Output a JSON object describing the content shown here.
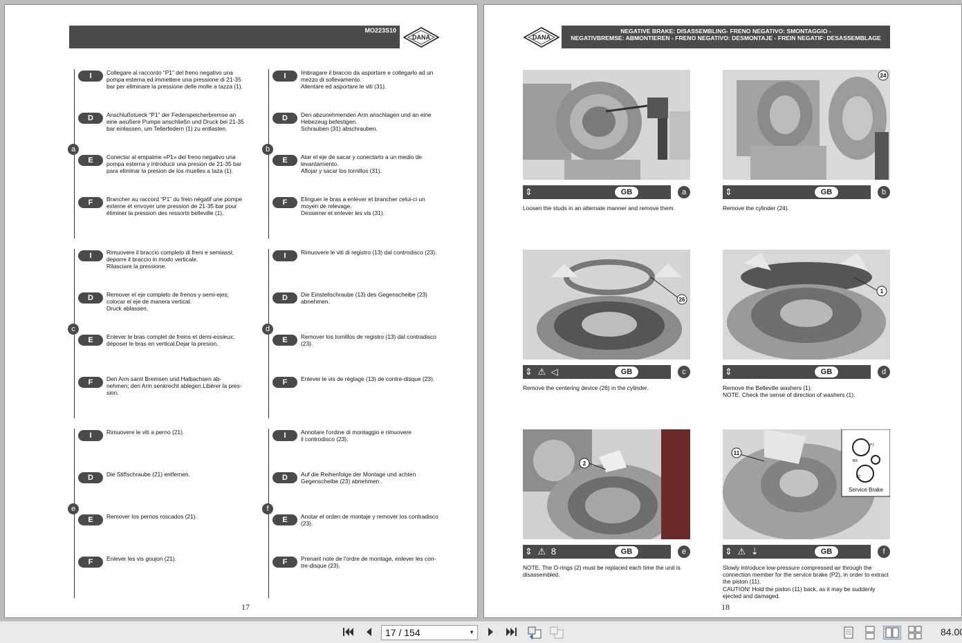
{
  "left_page": {
    "code": "MO223S10",
    "logo_text": "DANA",
    "page_number": "17",
    "blocks": [
      {
        "letter": "a",
        "rows": [
          {
            "lang": "I",
            "text": "Collegare al raccordo “P1” del freno negativo una\npompa esterna ed immettere una pressione di 21-35\nbar per eliminare la pressione delle molle a tazza (1)."
          },
          {
            "lang": "D",
            "text": "Anschlußstueck “P1” der Federspeicherbremse an\neine aeußere Pumpe anschließn und Druck bei 21-35\nbar einlassen, um Tellerfedern (1) zu entlasten."
          },
          {
            "lang": "E",
            "text": "Conectar al empalme «P1» del freno negativo una\npompa esterna y introducir una presion de 21-35 bar\npara eliminar la presion de los muelles a taza (1)."
          },
          {
            "lang": "F",
            "text": "Brancher au raccord “P1” du frein négatif une pompe\nexterne et envoyer une pression de 21-35 bar pour\néliminer la pression des ressorts belleville (1)."
          }
        ]
      },
      {
        "letter": "b",
        "rows": [
          {
            "lang": "I",
            "text": "Imbragare il braccio da asportare e collegarlo ad un\nmezzo di sollevamento.\nAllentare ed asportare le viti (31)."
          },
          {
            "lang": "D",
            "text": "Den abzunehmenden Arm anschlagen und an eine\nHebezeug befestigen.\nSchrauben (31) abschrauben."
          },
          {
            "lang": "E",
            "text": "Atar el eje de sacar y conectarlo a un medio de\nlevantamiento.\nAflojar y sacar los tornillos (31)."
          },
          {
            "lang": "F",
            "text": "Elinguer le bras a enlever et brancher celui-ci un\nmoyen de relevage.\nDesserrer et enlever les vis (31)."
          }
        ]
      },
      {
        "letter": "c",
        "rows": [
          {
            "lang": "I",
            "text": "Rimuovere il braccio completo di freni e semiassi;\ndeporre il braccio in modo verticale.\nRilasciare la pressione."
          },
          {
            "lang": "D",
            "text": "Remover el eje completo de frenos y semi-ejes;\ncolocar el eje de manera vertical.\nDruck ablassen."
          },
          {
            "lang": "E",
            "text": "Enlever le bras complet de freins et demi-essieux;\ndéposer le bras en vertical.Dejar la presion."
          },
          {
            "lang": "F",
            "text": "Den Arm samt Bremsen und Halbachsen ab-\nnehmen; den Arm senkrecht ablegen.Libérer la pres-\nsion."
          }
        ]
      },
      {
        "letter": "d",
        "rows": [
          {
            "lang": "I",
            "text": "Rimuovere le viti di registro (13) dal controdisco (23)."
          },
          {
            "lang": "D",
            "text": "Die Einstellschraube (13) des Gegenscheibe (23)\nabnehmen."
          },
          {
            "lang": "E",
            "text": "Remover los tornillos de registro (13) dal contradisco\n(23)."
          },
          {
            "lang": "F",
            "text": "Enlever le vis de règlage (13) de contre-disque (23)."
          }
        ]
      },
      {
        "letter": "e",
        "rows": [
          {
            "lang": "I",
            "text": "Rimuovere le viti a perno (21)."
          },
          {
            "lang": "D",
            "text": "Die Stiftschraube (21) entfernen."
          },
          {
            "lang": "E",
            "text": "Remover los pernos roscados (21)."
          },
          {
            "lang": "F",
            "text": "Enlever les vis goujon (21)."
          }
        ]
      },
      {
        "letter": "f",
        "rows": [
          {
            "lang": "I",
            "text": "Annotare l'ordine di montaggio e rimuovere\nil controdisco (23)."
          },
          {
            "lang": "D",
            "text": "Auf die Reihenfolge der Montage und achten\nGegenscheibe (23) abnehmen ."
          },
          {
            "lang": "E",
            "text": "Anotar el orden de montaje y remover los contradisco\n(23)."
          },
          {
            "lang": "F",
            "text": "Prenant note de l'ordre de montage, enlever les con-\ntre-disque (23)."
          }
        ]
      }
    ]
  },
  "right_page": {
    "logo_text": "DANA",
    "title_line1": "NEGATIVE BRAKE: DISASSEMBLING- FRENO NEGATIVO: SMONTAGGIO -",
    "title_line2": "NEGATIVBREMSE: ABMONTIEREN - FRENO NEGATIVO: DESMONTAJE - FREIN NEGATIF: DESASSEMBLAGE",
    "page_number": "18",
    "steps": [
      {
        "letter": "a",
        "badge": "GB",
        "icons": "⇕",
        "callouts": [],
        "text": "Loosen the studs in an alternate manner and remove them."
      },
      {
        "letter": "b",
        "badge": "GB",
        "icons": "⇕",
        "callouts": [
          "24"
        ],
        "text": "Remove the cylinder (24)."
      },
      {
        "letter": "c",
        "badge": "GB",
        "icons": "⇕ ⚠ ◁",
        "callouts": [
          "26"
        ],
        "text": "Remove the centering device (26) in the cylinder."
      },
      {
        "letter": "d",
        "badge": "GB",
        "icons": "⇕",
        "callouts": [
          "1"
        ],
        "text": "Remove the Belleville washers (1).\nNOTE. Check the sense of direction of washers (1)."
      },
      {
        "letter": "e",
        "badge": "GB",
        "icons": "⇕ ⚠ 8",
        "callouts": [
          "2"
        ],
        "text": "NOTE. The O-rings (2) must be replaced each time the unit is\ndisassembled."
      },
      {
        "letter": "f",
        "badge": "GB",
        "icons": "⇕ ⚠ ⇣",
        "callouts": [
          "11"
        ],
        "inset_label": "Service Brake",
        "inset_ports": [
          "P1",
          "BR",
          "P2"
        ],
        "text": "Slowly introduce low-pressure compressed air through the\nconnection member for the service brake (P2), in order to extract\nthe piston (11).\nCAUTION! Hold the piston (11) back, as it may be suddenly\nejected and damaged."
      }
    ]
  },
  "toolbar": {
    "first_icon": "first-page-icon",
    "prev_icon": "prev-page-icon",
    "page_field": "17 / 154",
    "next_icon": "next-page-icon",
    "last_icon": "last-page-icon",
    "zoom": "84.00"
  },
  "colors": {
    "header_bar": "#4a4a4a",
    "viewer_bg": "#bdbdbd",
    "toolbar_bg": "#e9e9e9"
  }
}
